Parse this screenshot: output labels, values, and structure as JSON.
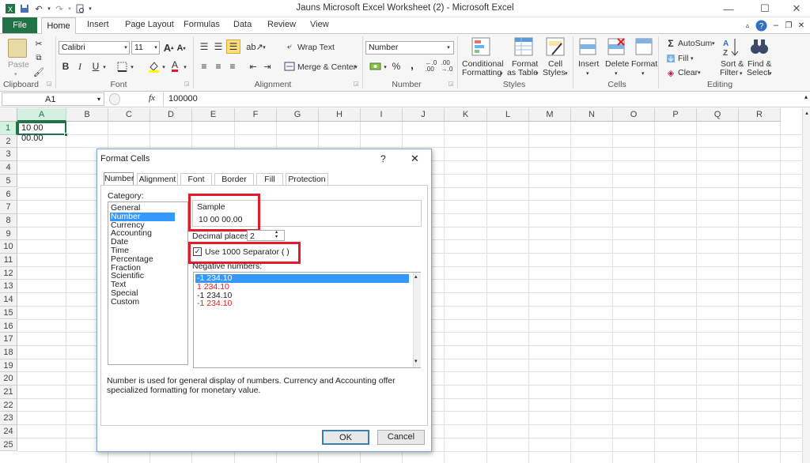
{
  "window": {
    "title": "Jauns Microsoft Excel Worksheet (2)  -  Microsoft Excel"
  },
  "tabs": {
    "file": "File",
    "home": "Home",
    "insert": "Insert",
    "page_layout": "Page Layout",
    "formulas": "Formulas",
    "data": "Data",
    "review": "Review",
    "view": "View"
  },
  "ribbon": {
    "clipboard": {
      "label": "Clipboard",
      "paste": "Paste"
    },
    "font": {
      "label": "Font",
      "font_name": "Calibri",
      "font_size": "11",
      "bold": "B",
      "italic": "I",
      "underline": "U"
    },
    "alignment": {
      "label": "Alignment",
      "wrap_text": "Wrap Text",
      "merge_center": "Merge & Center"
    },
    "number": {
      "label": "Number",
      "format": "Number",
      "percent": "%",
      "comma": ","
    },
    "styles": {
      "label": "Styles",
      "conditional_formatting_1": "Conditional",
      "conditional_formatting_2": "Formatting",
      "format_as_table_1": "Format",
      "format_as_table_2": "as Table",
      "cell_styles_1": "Cell",
      "cell_styles_2": "Styles"
    },
    "cells": {
      "label": "Cells",
      "insert": "Insert",
      "delete": "Delete",
      "format": "Format"
    },
    "editing": {
      "label": "Editing",
      "autosum": "AutoSum",
      "fill": "Fill",
      "clear": "Clear",
      "sort_filter_1": "Sort &",
      "sort_filter_2": "Filter",
      "find_select_1": "Find &",
      "find_select_2": "Select"
    }
  },
  "formula_bar": {
    "name_box": "A1",
    "fx": "fx",
    "value": "100000"
  },
  "grid": {
    "columns": [
      "A",
      "B",
      "C",
      "D",
      "E",
      "F",
      "G",
      "H",
      "I",
      "J",
      "K",
      "L",
      "M",
      "N",
      "O",
      "P",
      "Q",
      "R"
    ],
    "rows": [
      "1",
      "2",
      "3",
      "4",
      "5",
      "6",
      "7",
      "8",
      "9",
      "10",
      "11",
      "12",
      "13",
      "14",
      "15",
      "16",
      "17",
      "18",
      "19",
      "20",
      "21",
      "22",
      "23",
      "24",
      "25"
    ],
    "cell_a1": "10 00 00.00"
  },
  "dialog": {
    "title": "Format Cells",
    "help": "?",
    "close": "✕",
    "tabs": [
      "Number",
      "Alignment",
      "Font",
      "Border",
      "Fill",
      "Protection"
    ],
    "category_label": "Category:",
    "categories": [
      "General",
      "Number",
      "Currency",
      "Accounting",
      "Date",
      "Time",
      "Percentage",
      "Fraction",
      "Scientific",
      "Text",
      "Special",
      "Custom"
    ],
    "selected_category": "Number",
    "sample_label": "Sample",
    "sample_value": "10 00 00.00",
    "decimal_places_label": "Decimal places:",
    "decimal_places": "2",
    "use_separator_label": "Use 1000 Separator ( )",
    "use_separator_checked": true,
    "negative_numbers_label": "Negative numbers:",
    "negative_numbers": [
      {
        "text": "-1 234.10",
        "color": "#ffffff",
        "selected": true
      },
      {
        "text": "1 234.10",
        "color": "#e21c1c",
        "selected": false
      },
      {
        "text": "-1 234.10",
        "color": "#222222",
        "selected": false
      },
      {
        "text": "-1 234.10",
        "color": "#e21c1c",
        "selected": false
      }
    ],
    "description": "Number is used for general display of numbers.  Currency and Accounting offer specialized formatting for monetary value.",
    "ok": "OK",
    "cancel": "Cancel"
  },
  "colors": {
    "excel_green": "#217346",
    "selection_blue": "#3399ff",
    "highlight_red": "#e21c2a"
  }
}
